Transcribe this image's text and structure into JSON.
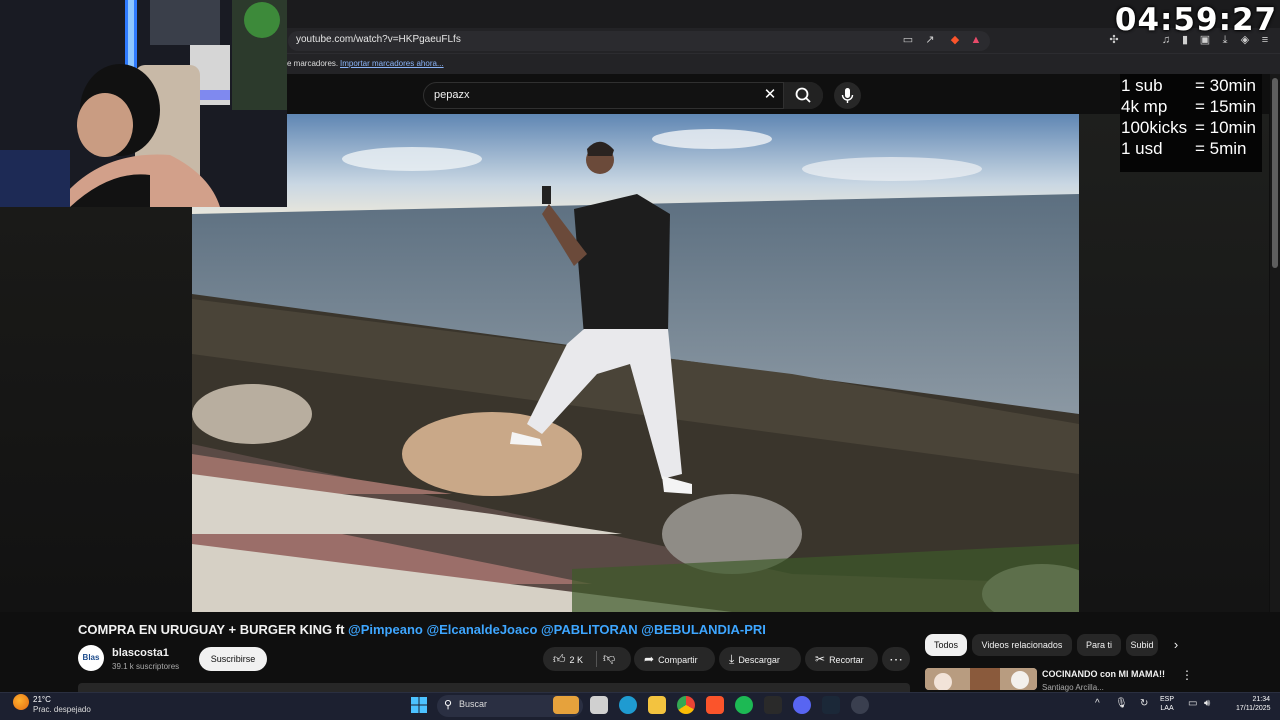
{
  "stream": {
    "timer": "04:59:27",
    "rules": [
      {
        "key": "1 sub",
        "value": "= 30min"
      },
      {
        "key": "4k mp",
        "value": "= 15min"
      },
      {
        "key": "100kicks",
        "value": "= 10min"
      },
      {
        "key": "1 usd",
        "value": "= 5min"
      }
    ]
  },
  "browser": {
    "url": "youtube.com/watch?v=HKPgaeuFLfs",
    "bookmarks_label": "e marcadores.",
    "bookmarks_link": "Importar marcadores ahora..."
  },
  "youtube": {
    "search_value": "pepazx",
    "video_title_main": "COMPRA EN URUGUAY + BURGER KING ft ",
    "video_title_mentions": "@Pimpeano @ElcanaldeJoaco @PABLITORAN @BEBULANDIA-PRI",
    "channel_avatar_text": "Blas",
    "channel_name": "blascosta1",
    "channel_subs": "39.1 k suscriptores",
    "subscribe_label": "Suscribirse",
    "likes": "2 K",
    "share_label": "Compartir",
    "download_label": "Descargar",
    "clip_label": "Recortar",
    "more_label": "⋯",
    "chips": [
      "Todos",
      "Videos relacionados",
      "Para ti",
      "Subid"
    ],
    "recommended_title": "COCINANDO con MI MAMA!!",
    "recommended_channel": "Santiago Arcilla..."
  },
  "taskbar": {
    "temperature": "21°C",
    "weather": "Prac. despejado",
    "search_placeholder": "Buscar",
    "lang_1": "ESP",
    "lang_2": "LAA",
    "time": "21:34",
    "date": "17/11/2025"
  },
  "colors": {
    "accent_link": "#3ea6ff",
    "youtube_bg": "#0f0f0f",
    "taskbar_bg": "#1c2030"
  }
}
